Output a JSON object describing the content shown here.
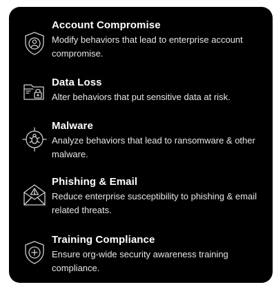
{
  "items": [
    {
      "icon": "shield-user-icon",
      "title": "Account Compromise",
      "description": "Modify behaviors that lead to enterprise account compromise."
    },
    {
      "icon": "folder-lock-icon",
      "title": "Data Loss",
      "description": "Alter behaviors that put sensitive data at risk."
    },
    {
      "icon": "bug-target-icon",
      "title": "Malware",
      "description": "Analyze behaviors that lead to ransomware & other malware."
    },
    {
      "icon": "envelope-warning-icon",
      "title": "Phishing & Email",
      "description": "Reduce enterprise susceptibility to phishing & email related threats."
    },
    {
      "icon": "shield-plus-icon",
      "title": "Training Compliance",
      "description": "Ensure org-wide security awareness training compliance."
    }
  ],
  "colors": {
    "card_background": "#000000",
    "text": "#ffffff",
    "icon_stroke": "#cfcfcf"
  }
}
